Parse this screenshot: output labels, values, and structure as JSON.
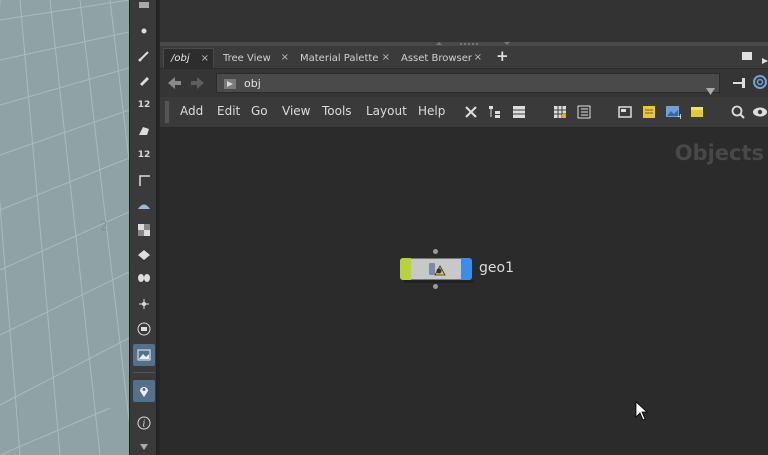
{
  "tabs": [
    {
      "label": "/obj",
      "active": true
    },
    {
      "label": "Tree View"
    },
    {
      "label": "Material Palette"
    },
    {
      "label": "Asset Browser"
    }
  ],
  "tab_close_glyph": "×",
  "tab_add_glyph": "+",
  "path": {
    "value": "obj"
  },
  "menu": [
    "Add",
    "Edit",
    "Go",
    "View",
    "Tools",
    "Layout",
    "Help"
  ],
  "network": {
    "context_label": "Objects"
  },
  "node": {
    "name": "geo1",
    "flag_left_color": "#b6d43a",
    "flag_right_color": "#3a8ee8"
  },
  "toolstrip_tools": [
    {
      "icon": "point-icon"
    },
    {
      "icon": "brush-icon"
    },
    {
      "icon": "pen-icon"
    },
    {
      "icon": "number-12-icon",
      "text": "12"
    },
    {
      "icon": "paint-icon"
    },
    {
      "icon": "number-12-paint-icon",
      "text": "12"
    },
    {
      "icon": "corner-icon"
    },
    {
      "icon": "drape-icon"
    },
    {
      "icon": "checker-icon"
    },
    {
      "icon": "layers-icon"
    },
    {
      "icon": "butterfly-icon"
    },
    {
      "icon": "scatter-icon"
    },
    {
      "icon": "circle-stop-icon"
    },
    {
      "icon": "image-icon"
    },
    {
      "icon": "location-pin-icon"
    },
    {
      "icon": "info-icon",
      "text": "i"
    }
  ],
  "toolstrip_top_number": "12"
}
